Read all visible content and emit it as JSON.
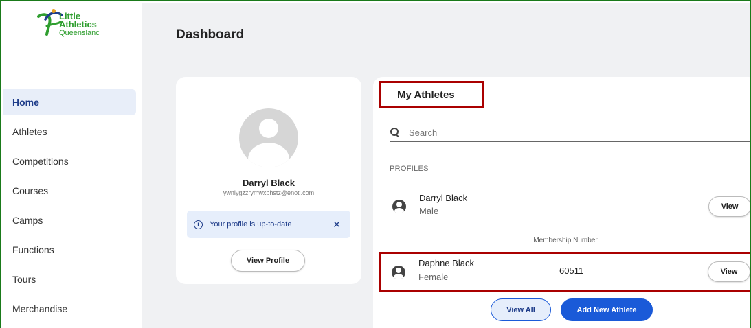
{
  "brand": {
    "line1": "Little",
    "line2": "Athletics",
    "line3": "Queenslanc",
    "colors": {
      "green": "#2f9e2f",
      "blue": "#1f3d8a",
      "orange": "#e8a020"
    }
  },
  "sidebar": {
    "items": [
      {
        "label": "Home",
        "active": true
      },
      {
        "label": "Athletes"
      },
      {
        "label": "Competitions"
      },
      {
        "label": "Courses"
      },
      {
        "label": "Camps"
      },
      {
        "label": "Functions"
      },
      {
        "label": "Tours"
      },
      {
        "label": "Merchandise"
      }
    ]
  },
  "header": {
    "title": "Dashboard"
  },
  "profile": {
    "name": "Darryl Black",
    "email": "ywniygzzrymwxbhstz@enotj.com",
    "status": "Your profile is up-to-date",
    "close_icon": "✕",
    "info_icon": "i",
    "view_profile_label": "View Profile"
  },
  "athletes": {
    "title": "My Athletes",
    "search_placeholder": "Search",
    "profiles_label": "PROFILES",
    "membership_header": "Membership Number",
    "rows": [
      {
        "name": "Darryl Black",
        "gender": "Male",
        "number": "",
        "view_label": "View"
      },
      {
        "name": "Daphne Black",
        "gender": "Female",
        "number": "60511",
        "view_label": "View"
      }
    ],
    "view_all_label": "View All",
    "add_label": "Add New Athlete"
  },
  "colors": {
    "accent": "#1a5ad8",
    "highlight": "#aa0000",
    "frame": "#1a7a1a"
  }
}
